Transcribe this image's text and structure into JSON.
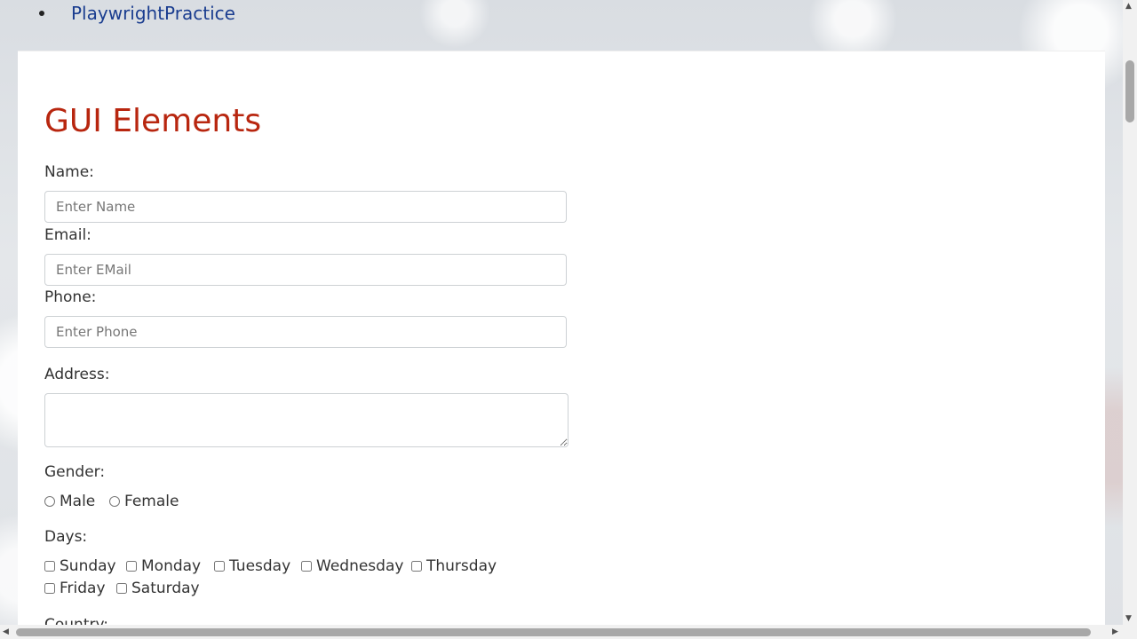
{
  "top_nav": {
    "link": "PlaywrightPractice"
  },
  "page": {
    "title": "GUI Elements",
    "name_label": "Name:",
    "name_placeholder": "Enter Name",
    "email_label": "Email:",
    "email_placeholder": "Enter EMail",
    "phone_label": "Phone:",
    "phone_placeholder": "Enter Phone",
    "address_label": "Address:",
    "gender_label": "Gender:",
    "gender_options": [
      "Male",
      "Female"
    ],
    "days_label": "Days:",
    "days": [
      "Sunday",
      "Monday",
      "Tuesday",
      "Wednesday",
      "Thursday",
      "Friday",
      "Saturday"
    ],
    "country_label": "Country:"
  },
  "colors": {
    "title": "#b8260f",
    "link": "#1a3d8f"
  }
}
